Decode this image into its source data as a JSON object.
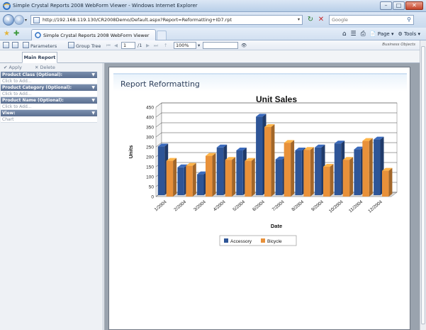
{
  "window": {
    "title": "Simple Crystal Reports 2008 WebForm Viewer - Windows Internet Explorer"
  },
  "browser": {
    "url": "http://192.168.119.130/CR2008Demo/Default.aspx?Report=Reformatting+ID7.rpt",
    "search_placeholder": "Google",
    "tab_label": "Simple Crystal Reports 2008 WebForm Viewer",
    "commands": {
      "page": "Page",
      "tools": "Tools"
    }
  },
  "crystal_toolbar": {
    "parameters_label": "Parameters",
    "group_tree_label": "Group Tree",
    "page_number": "1",
    "page_total": "/1",
    "zoom_value": "100%",
    "logo": "Business Objects"
  },
  "main_tab": {
    "label": "Main Report"
  },
  "left_panel": {
    "apply_label": "Apply",
    "delete_label": "Delete",
    "groups": [
      {
        "header": "Product Class (Optional):",
        "value": "Click to Add..."
      },
      {
        "header": "Product Category (Optional):",
        "value": "Click to Add..."
      },
      {
        "header": "Product Name (Optional):",
        "value": "Click to Add..."
      },
      {
        "header": "View:",
        "value": "Chart"
      }
    ]
  },
  "report": {
    "title": "Report Reformatting"
  },
  "chart_data": {
    "type": "bar",
    "title": "Unit Sales",
    "xlabel": "Date",
    "ylabel": "Units",
    "ylim": [
      0,
      450
    ],
    "yticks": [
      0,
      50,
      100,
      150,
      200,
      250,
      300,
      350,
      400,
      450
    ],
    "categories": [
      "1/2004",
      "2/2004",
      "3/2004",
      "4/2004",
      "5/2004",
      "6/2004",
      "7/2004",
      "8/2004",
      "9/2004",
      "10/2004",
      "11/2004",
      "12/2004"
    ],
    "series": [
      {
        "name": "Accessory",
        "color": "#2e5597",
        "values": [
          245,
          140,
          105,
          240,
          225,
          395,
          180,
          225,
          240,
          260,
          230,
          280
        ]
      },
      {
        "name": "Bicycle",
        "color": "#e8913a",
        "values": [
          180,
          155,
          205,
          185,
          180,
          350,
          270,
          235,
          150,
          185,
          280,
          130
        ]
      }
    ],
    "grid": true,
    "legend_position": "bottom"
  }
}
